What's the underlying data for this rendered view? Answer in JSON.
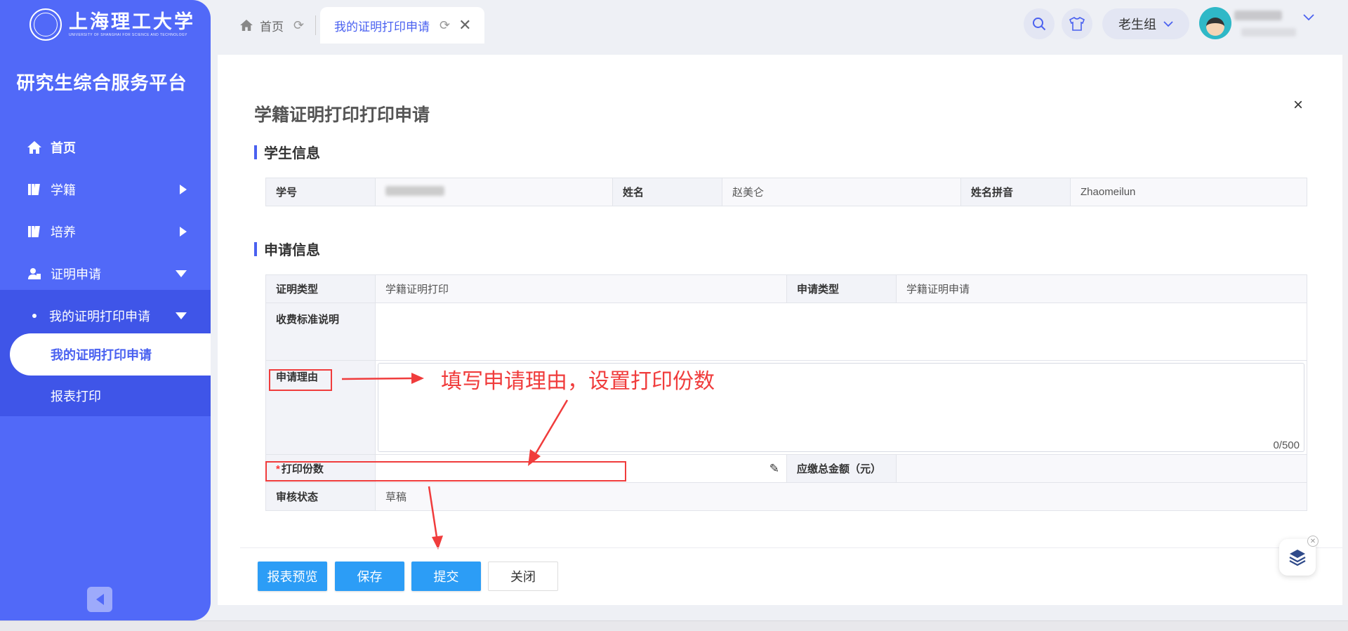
{
  "sidebar": {
    "logo_cn": "上海理工大学",
    "logo_en": "UNIVERSITY OF SHANGHAI FOR SCIENCE AND TECHNOLOGY",
    "platform_title": "研究生综合服务平台",
    "items": [
      {
        "label": "首页",
        "icon": "home-icon"
      },
      {
        "label": "学籍",
        "icon": "book-icon"
      },
      {
        "label": "培养",
        "icon": "book-icon"
      },
      {
        "label": "证明申请",
        "icon": "user-doc-icon"
      }
    ],
    "sub_item": "我的证明打印申请",
    "leaf_active": "我的证明打印申请",
    "leaf_other": "报表打印",
    "accent": "#5169f8"
  },
  "topbar": {
    "tab_home": "首页",
    "tab_active": "我的证明打印申请",
    "group_label": "老生组"
  },
  "dialog": {
    "title": "学籍证明打印打印申请",
    "close_symbol": "×"
  },
  "student": {
    "section_title": "学生信息",
    "id_label": "学号",
    "name_label": "姓名",
    "name_value": "赵美仑",
    "pinyin_label": "姓名拼音",
    "pinyin_value": "Zhaomeilun"
  },
  "application": {
    "section_title": "申请信息",
    "cert_type_label": "证明类型",
    "cert_type_value": "学籍证明打印",
    "apply_type_label": "申请类型",
    "apply_type_value": "学籍证明申请",
    "fee_label": "收费标准说明",
    "reason_label": "申请理由",
    "reason_count": "0/500",
    "copies_label": "打印份数",
    "amount_label": "应缴总金额（元）",
    "status_label": "审核状态",
    "status_value": "草稿"
  },
  "annotation": {
    "text": "填写申请理由，设置打印份数",
    "color": "#f03c3c"
  },
  "buttons": {
    "preview": "报表预览",
    "save": "保存",
    "submit": "提交",
    "close": "关闭"
  }
}
